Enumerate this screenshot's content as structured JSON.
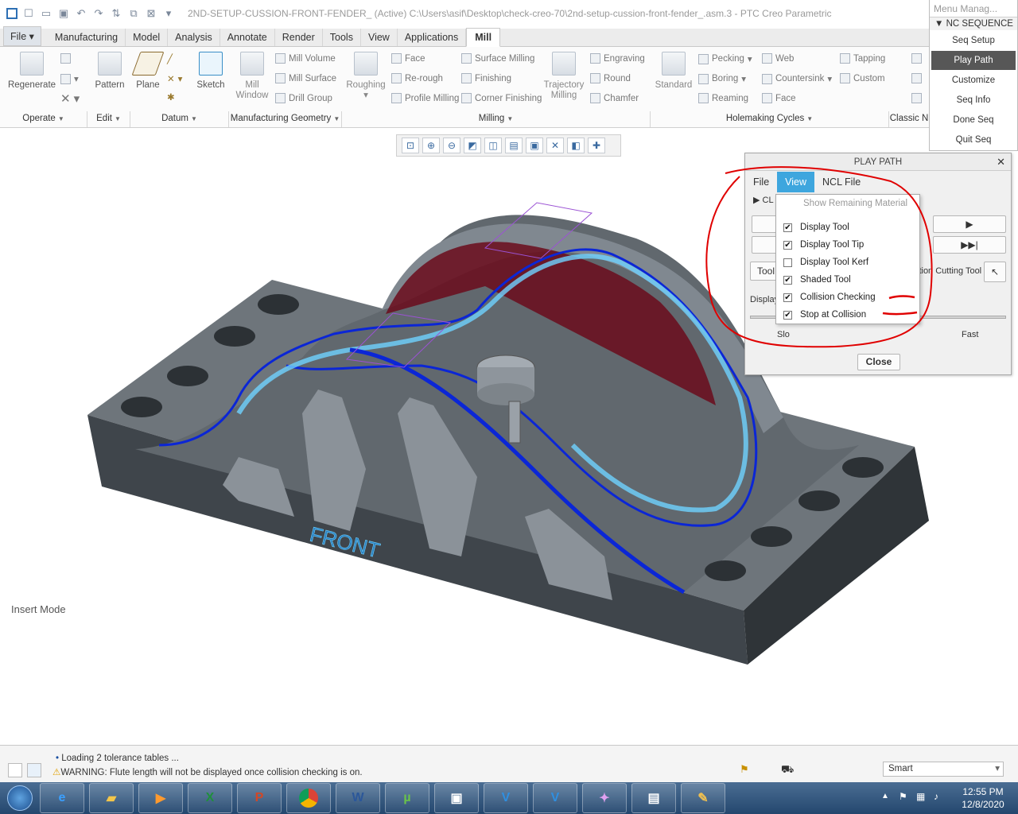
{
  "titlebar": {
    "title": "2ND-SETUP-CUSSION-FRONT-FENDER_ (Active) C:\\Users\\asif\\Desktop\\check-creo-70\\2nd-setup-cussion-front-fender_.asm.3 - PTC Creo Parametric"
  },
  "tabs": [
    "File",
    "Manufacturing",
    "Model",
    "Analysis",
    "Annotate",
    "Render",
    "Tools",
    "View",
    "Applications",
    "Mill"
  ],
  "active_tab": "Mill",
  "ribbon": {
    "regenerate": "Regenerate",
    "pattern": "Pattern",
    "plane": "Plane",
    "sketch": "Sketch",
    "mill_window": "Mill Window",
    "mill_volume": "Mill Volume",
    "mill_surface": "Mill Surface",
    "drill_group": "Drill Group",
    "roughing": "Roughing",
    "face": "Face",
    "rerough": "Re-rough",
    "profile_milling": "Profile Milling",
    "surface_milling": "Surface Milling",
    "finishing": "Finishing",
    "corner_finishing": "Corner Finishing",
    "trajectory_milling": "Trajectory Milling",
    "engraving": "Engraving",
    "round": "Round",
    "chamfer": "Chamfer",
    "standard": "Standard",
    "pecking": "Pecking",
    "boring": "Boring",
    "reaming": "Reaming",
    "web": "Web",
    "countersink": "Countersink",
    "face2": "Face",
    "tapping": "Tapping",
    "custom": "Custom",
    "groups": [
      "Operate",
      "Edit",
      "Datum",
      "Manufacturing Geometry",
      "Milling",
      "Holemaking Cycles",
      "Classic N"
    ]
  },
  "view_toolbar": [
    "zoom-fit-icon",
    "zoom-in-icon",
    "zoom-out-icon",
    "repaint-icon",
    "saved-orientation-icon",
    "view-manager-icon",
    "display-style-icon",
    "datum-display-icon",
    "annotation-icon",
    "spin-center-icon"
  ],
  "model": {
    "label": "FRONT",
    "colors": {
      "body": "#4a4f55",
      "top": "#6c7379",
      "path": "#0b26d6",
      "highlight": "#6fd2ff",
      "stock": "#6b0c1c",
      "background": "#ffffff"
    }
  },
  "insert_mode": "Insert Mode",
  "menu_manager": {
    "title": "Menu Manag...",
    "section": "NC SEQUENCE",
    "items": [
      "Seq Setup",
      "Play Path",
      "Customize",
      "Seq Info",
      "Done Seq",
      "Quit Seq"
    ],
    "selected": "Play Path"
  },
  "play_path": {
    "title": "PLAY PATH",
    "menus": [
      "File",
      "View",
      "NCL File"
    ],
    "open_menu": "View",
    "cl_label": "CL",
    "tool_button": "Tool",
    "display_label": "Display",
    "cutting_tool_label": "ition Cutting Tool",
    "slow": "Slo",
    "fast": "Fast",
    "close": "Close",
    "view_menu": [
      {
        "label": "Show Remaining Material",
        "enabled": false,
        "checked": null
      },
      {
        "label": "Display Tool",
        "enabled": true,
        "checked": true
      },
      {
        "label": "Display Tool Tip",
        "enabled": true,
        "checked": true
      },
      {
        "label": "Display Tool Kerf",
        "enabled": true,
        "checked": false
      },
      {
        "label": "Shaded Tool",
        "enabled": true,
        "checked": true
      },
      {
        "label": "Collision Checking",
        "enabled": true,
        "checked": true
      },
      {
        "label": "Stop at Collision",
        "enabled": true,
        "checked": true
      }
    ]
  },
  "status": {
    "line1": "Loading 2 tolerance tables ...",
    "line2": "WARNING: Flute length will not be displayed once collision checking is on.",
    "filter": "Smart"
  },
  "taskbar": {
    "apps": [
      "Internet Explorer",
      "File Explorer",
      "Media Player",
      "Excel",
      "PowerPoint",
      "Chrome",
      "Word",
      "uTorrent",
      "Window",
      "Creo",
      "Creo",
      "Paint 3D",
      "Network",
      "Paint"
    ],
    "time": "12:55 PM",
    "date": "12/8/2020"
  }
}
